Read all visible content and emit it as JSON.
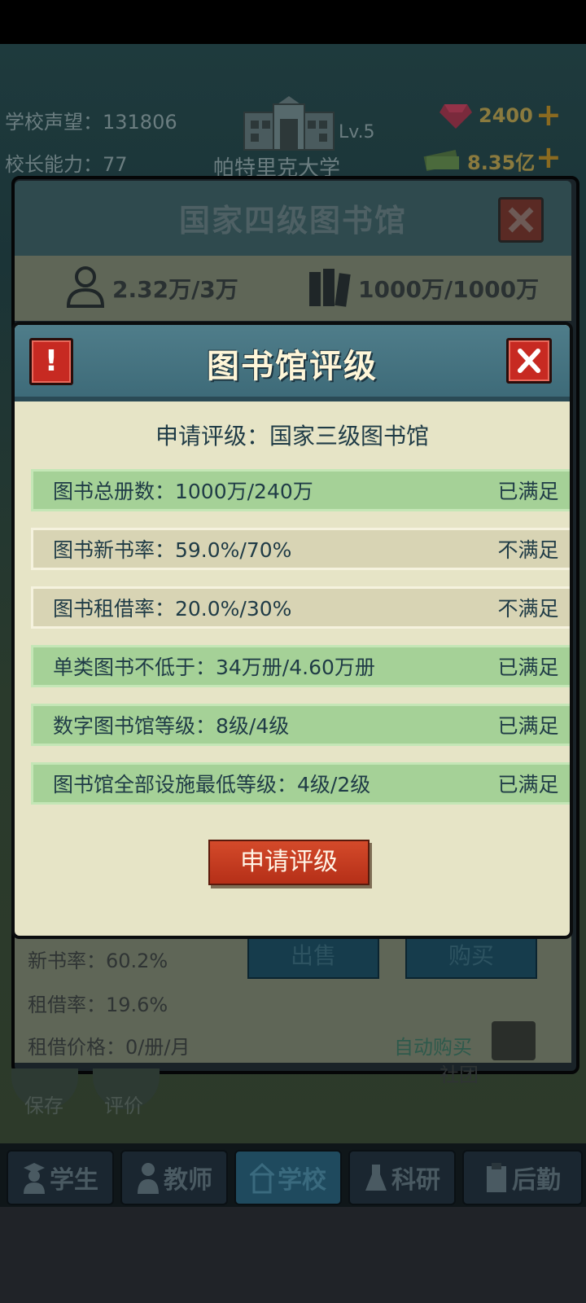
{
  "hud": {
    "reputation_label": "学校声望：",
    "reputation_value": "131806",
    "ability_label": "校长能力：",
    "ability_value": "77",
    "level": "Lv.5",
    "school_name": "帕特里克大学",
    "gems": "2400",
    "money": "8.35亿"
  },
  "library_panel": {
    "title": "国家四级图书馆",
    "students_stat": "2.32万/3万",
    "books_stat": "1000万/1000万",
    "new_book_rate": "新书率：60.2%",
    "borrow_rate": "租借率：19.6%",
    "borrow_price": "租借价格：0/册/月",
    "sell_label": "出售",
    "buy_label": "购买",
    "auto_buy_label": "自动购买",
    "map_label": "社团"
  },
  "modal": {
    "title": "图书馆评级",
    "alert_icon": "!",
    "close_icon": "✕",
    "subtitle": "申请评级：国家三级图书馆",
    "requirements": [
      {
        "label": "图书总册数：1000万/240万",
        "status": "已满足",
        "met": true
      },
      {
        "label": "图书新书率：59.0%/70%",
        "status": "不满足",
        "met": false
      },
      {
        "label": "图书租借率：20.0%/30%",
        "status": "不满足",
        "met": false
      },
      {
        "label": "单类图书不低于：34万册/4.60万册",
        "status": "已满足",
        "met": true
      },
      {
        "label": "数字图书馆等级：8级/4级",
        "status": "已满足",
        "met": true
      },
      {
        "label": "图书馆全部设施最低等级：4级/2级",
        "status": "已满足",
        "met": true
      }
    ],
    "apply_button": "申请评级"
  },
  "side_buttons": {
    "save": "保存",
    "review": "评价"
  },
  "bottom_nav": [
    {
      "label": "学生",
      "icon": "student-icon"
    },
    {
      "label": "教师",
      "icon": "teacher-icon"
    },
    {
      "label": "学校",
      "icon": "school-icon",
      "active": true
    },
    {
      "label": "科研",
      "icon": "flask-icon"
    },
    {
      "label": "后勤",
      "icon": "clipboard-icon"
    }
  ],
  "colors": {
    "met_row": "#a5d197",
    "unmet_row": "#d8d4b4",
    "accent_red": "#c72a22",
    "header_teal": "#4f7d8a"
  }
}
